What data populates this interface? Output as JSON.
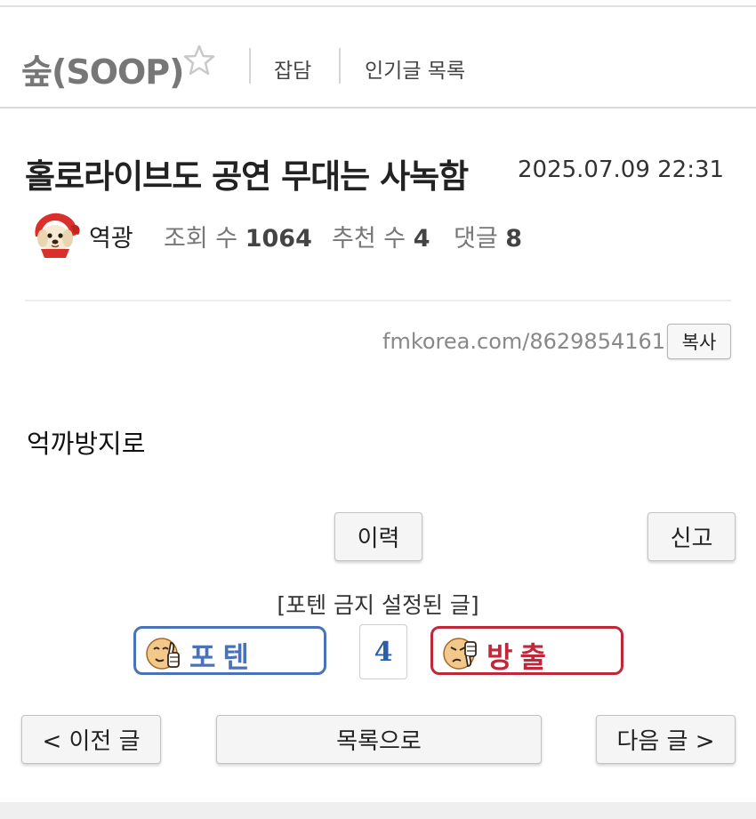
{
  "board": {
    "title": "숲(SOOP)",
    "links": [
      "잡담",
      "인기글 목록"
    ]
  },
  "icons": {
    "favorite": "star-outline-icon",
    "avatar": "puppy-red-hood-avatar",
    "thumbs_up": "thumbs-up-face-icon",
    "thumbs_down": "thumbs-down-face-icon"
  },
  "post": {
    "title": "홀로라이브도 공연 무대는 사녹함",
    "date": "2025.07.09 22:31",
    "author": "역광",
    "views_label": "조회 수",
    "views": "1064",
    "recommend_label": "추천 수",
    "recommend": "4",
    "comments_label": "댓글",
    "comments": "8",
    "url": "fmkorea.com/8629854161",
    "copy_label": "복사",
    "body": "억까방지로"
  },
  "actions": {
    "history_label": "이력",
    "report_label": "신고",
    "notice": "[포텐 금지 설정된 글]",
    "upvote_label": "포텐",
    "vote_count": "4",
    "downvote_label": "방출"
  },
  "nav": {
    "prev_label": "< 이전 글",
    "list_label": "목록으로",
    "next_label": "다음 글 >"
  },
  "colors": {
    "upvote": "#4a72b8",
    "downvote": "#c0283a",
    "count": "#2a5ea8"
  }
}
